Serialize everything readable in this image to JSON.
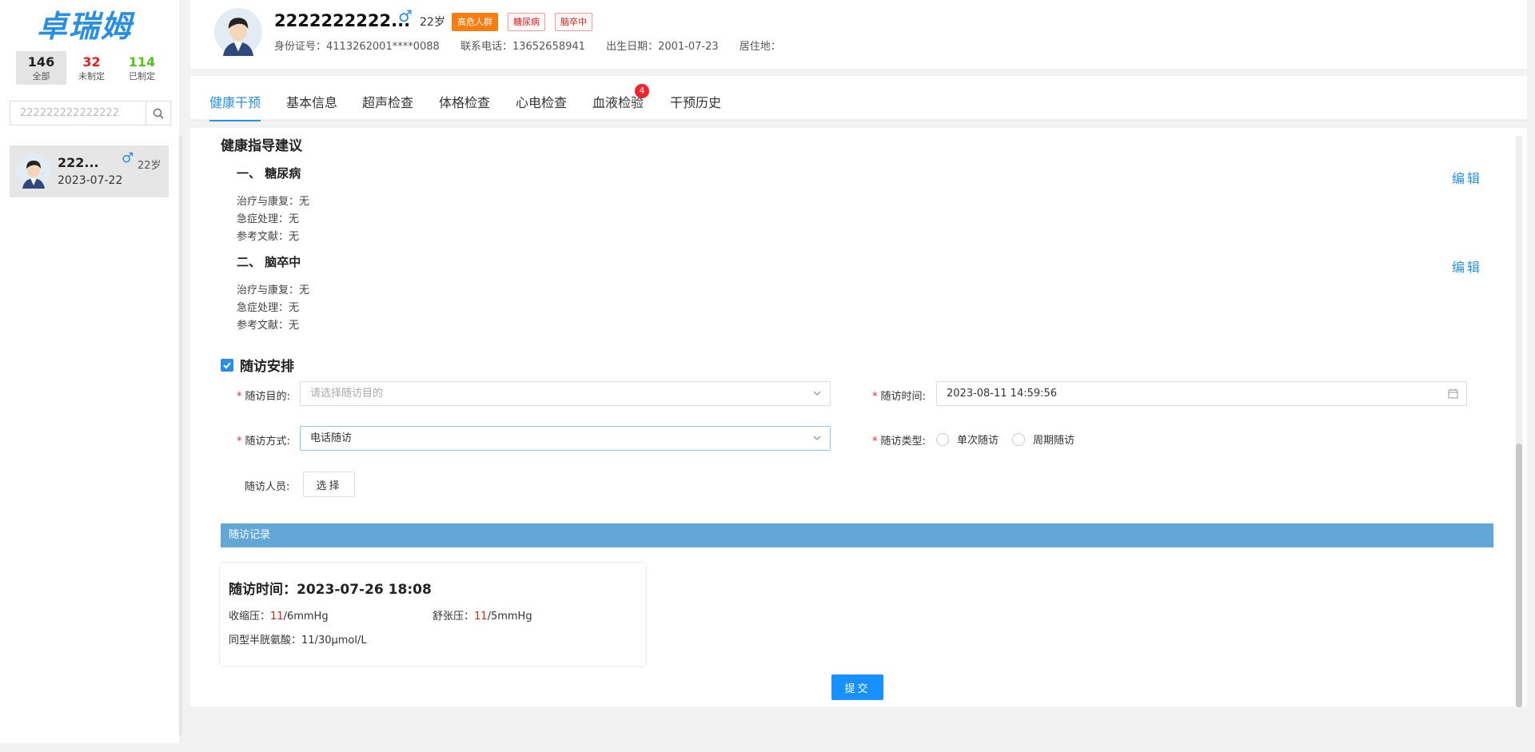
{
  "sidebar": {
    "logo": "卓瑞姆",
    "stats": [
      {
        "num": "146",
        "label": "全部"
      },
      {
        "num": "32",
        "label": "未制定"
      },
      {
        "num": "114",
        "label": "已制定"
      }
    ],
    "search": {
      "value": "222222222222222"
    },
    "patient": {
      "name": "222...",
      "gender": "♂",
      "age": "22岁",
      "date": "2023-07-22"
    }
  },
  "header": {
    "name": "2222222222...",
    "gender": "♂",
    "age": "22岁",
    "tags": [
      "高危人群",
      "糖尿病",
      "脑卒中"
    ],
    "id_card": "身份证号：4113262001****0088",
    "phone": "联系电话：13652658941",
    "birth": "出生日期：2001-07-23",
    "address": "居住地："
  },
  "tabs": [
    {
      "label": "健康干预"
    },
    {
      "label": "基本信息"
    },
    {
      "label": "超声检查"
    },
    {
      "label": "体格检查"
    },
    {
      "label": "心电检查"
    },
    {
      "label": "血液检验"
    },
    {
      "label": "干预历史"
    }
  ],
  "tab_badge": "4",
  "guidance": {
    "title": "健康指导建议",
    "edit_label": "编辑",
    "diseases": [
      {
        "title": "一、 糖尿病",
        "lines": [
          {
            "key": "治疗与康复：",
            "val": "无"
          },
          {
            "key": "急症处理：",
            "val": "无"
          },
          {
            "key": "参考文献：",
            "val": "无"
          }
        ]
      },
      {
        "title": "二、 脑卒中",
        "lines": [
          {
            "key": "治疗与康复：",
            "val": "无"
          },
          {
            "key": "急症处理：",
            "val": "无"
          },
          {
            "key": "参考文献：",
            "val": "无"
          }
        ]
      }
    ]
  },
  "followup": {
    "title": "随访安排",
    "purpose_label": "随访目的:",
    "purpose_placeholder": "请选择随访目的",
    "time_label": "随访时间:",
    "time_value": "2023-08-11 14:59:56",
    "method_label": "随访方式:",
    "method_value": "电话随访",
    "type_label": "随访类型:",
    "type_options": [
      "单次随访",
      "周期随访"
    ],
    "staff_label": "随访人员:",
    "choose_label": "选择"
  },
  "records": {
    "bar_title": "随访记录",
    "time": "随访时间：2023-07-26 18:08",
    "systolic_label": "收缩压：",
    "systolic_a": "11",
    "systolic_b": "/6mmHg",
    "diastolic_label": "舒张压：",
    "diastolic_a": "11",
    "diastolic_b": "/5mmHg",
    "hcy_label": "同型半胱氨酸：",
    "hcy_value": "11/30μmol/L"
  },
  "submit_label": "提交",
  "colors": {
    "accent": "#2a8fe4",
    "tag_orange": "#fa7d14",
    "danger": "#e02020",
    "record_bar": "#63a6d8"
  }
}
